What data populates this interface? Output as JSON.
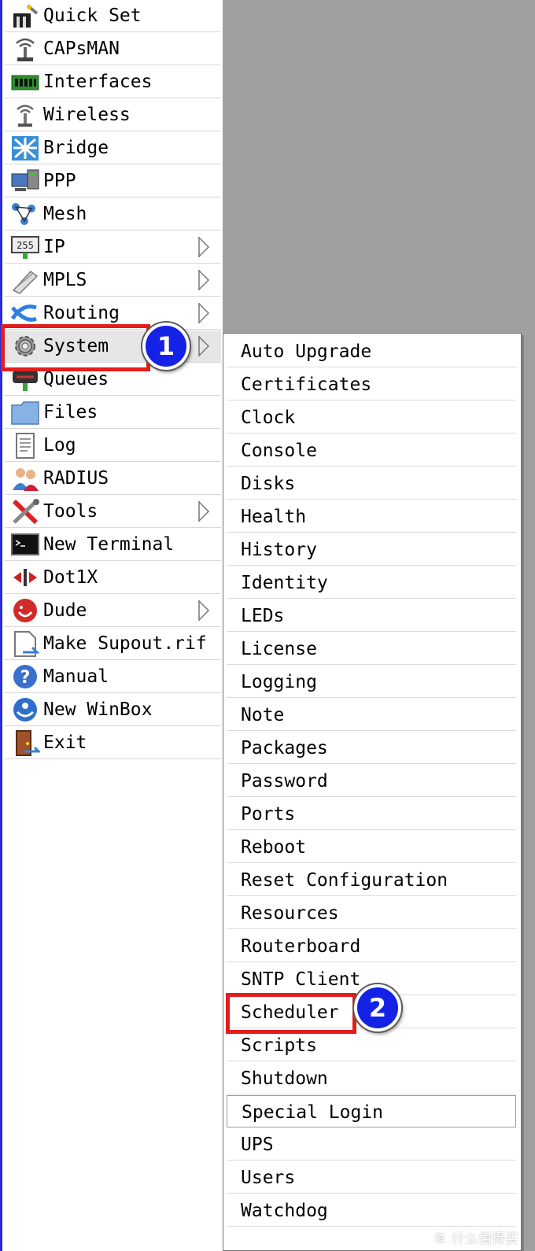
{
  "main_menu": {
    "items": [
      {
        "label": "Quick Set",
        "icon": "quick-set-icon",
        "has_submenu": false
      },
      {
        "label": "CAPsMAN",
        "icon": "capsman-icon",
        "has_submenu": false
      },
      {
        "label": "Interfaces",
        "icon": "interfaces-icon",
        "has_submenu": false
      },
      {
        "label": "Wireless",
        "icon": "wireless-icon",
        "has_submenu": false
      },
      {
        "label": "Bridge",
        "icon": "bridge-icon",
        "has_submenu": false
      },
      {
        "label": "PPP",
        "icon": "ppp-icon",
        "has_submenu": false
      },
      {
        "label": "Mesh",
        "icon": "mesh-icon",
        "has_submenu": false
      },
      {
        "label": "IP",
        "icon": "ip-icon",
        "has_submenu": true
      },
      {
        "label": "MPLS",
        "icon": "mpls-icon",
        "has_submenu": true
      },
      {
        "label": "Routing",
        "icon": "routing-icon",
        "has_submenu": true
      },
      {
        "label": "System",
        "icon": "gear-icon",
        "has_submenu": true,
        "active": true
      },
      {
        "label": "Queues",
        "icon": "queues-icon",
        "has_submenu": false
      },
      {
        "label": "Files",
        "icon": "folder-icon",
        "has_submenu": false
      },
      {
        "label": "Log",
        "icon": "log-icon",
        "has_submenu": false
      },
      {
        "label": "RADIUS",
        "icon": "radius-users-icon",
        "has_submenu": false
      },
      {
        "label": "Tools",
        "icon": "tools-icon",
        "has_submenu": true
      },
      {
        "label": "New Terminal",
        "icon": "terminal-icon",
        "has_submenu": false
      },
      {
        "label": "Dot1X",
        "icon": "dot1x-icon",
        "has_submenu": false
      },
      {
        "label": "Dude",
        "icon": "dude-icon",
        "has_submenu": true
      },
      {
        "label": "Make Supout.rif",
        "icon": "supout-file-icon",
        "has_submenu": false
      },
      {
        "label": "Manual",
        "icon": "help-icon",
        "has_submenu": false
      },
      {
        "label": "New WinBox",
        "icon": "winbox-icon",
        "has_submenu": false
      },
      {
        "label": "Exit",
        "icon": "exit-door-icon",
        "has_submenu": false
      }
    ]
  },
  "system_submenu": {
    "items": [
      "Auto Upgrade",
      "Certificates",
      "Clock",
      "Console",
      "Disks",
      "Health",
      "History",
      "Identity",
      "LEDs",
      "License",
      "Logging",
      "Note",
      "Packages",
      "Password",
      "Ports",
      "Reboot",
      "Reset Configuration",
      "Resources",
      "Routerboard",
      "SNTP Client",
      "Scheduler",
      "Scripts",
      "Shutdown",
      "Special Login",
      "UPS",
      "Users",
      "Watchdog"
    ],
    "focused_item": "Special Login"
  },
  "annotations": {
    "step1_number": "1",
    "step2_number": "2",
    "highlight_color": "#e21d1d",
    "badge_color": "#1422e6"
  },
  "watermark": {
    "symbol": "值",
    "text": "什么值得买"
  }
}
